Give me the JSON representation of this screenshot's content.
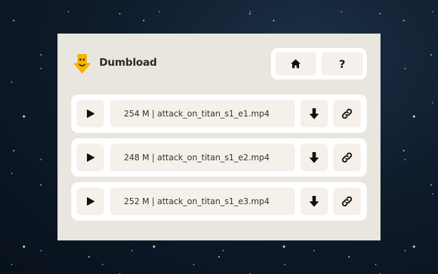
{
  "app": {
    "name": "Dumbload",
    "logo_icon": "arrow-down-face-logo",
    "accent_color": "#f4b400"
  },
  "nav": [
    {
      "icon": "home-icon",
      "label": "Home"
    },
    {
      "icon": "help-icon",
      "label": "?"
    }
  ],
  "files": [
    {
      "size": "254 M",
      "separator": " | ",
      "name": "attack_on_titan_s1_e1.mp4"
    },
    {
      "size": "248 M",
      "separator": " | ",
      "name": "attack_on_titan_s1_e2.mp4"
    },
    {
      "size": "252 M",
      "separator": " | ",
      "name": "attack_on_titan_s1_e3.mp4"
    }
  ],
  "row_actions": {
    "play_icon": "play-icon",
    "download_icon": "download-icon",
    "link_icon": "link-icon"
  }
}
